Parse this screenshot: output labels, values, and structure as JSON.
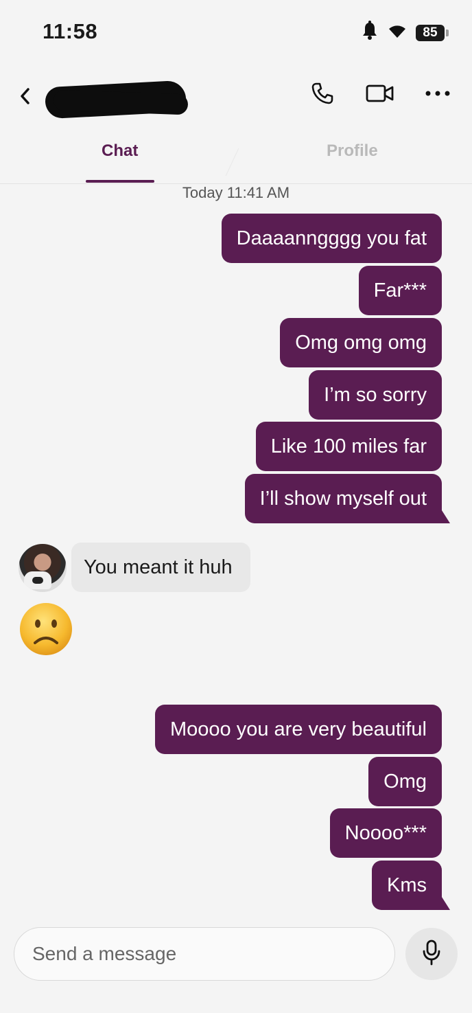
{
  "status_bar": {
    "time": "11:58",
    "battery": "85",
    "icons": [
      "bell-icon",
      "wifi-icon",
      "battery-icon"
    ]
  },
  "header": {
    "back_icon": "chevron-left-icon",
    "contact_name": "",
    "actions": [
      "phone-icon",
      "video-icon",
      "more-icon"
    ]
  },
  "tabs": {
    "chat": "Chat",
    "profile": "Profile",
    "active": "Chat"
  },
  "conversation": {
    "timestamp": "Today 11:41 AM",
    "outgoing_group_1": [
      "Daaaanngggg you fat",
      "Far***",
      "Omg omg omg",
      "I’m so sorry",
      "Like 100 miles far",
      "I’ll show myself out"
    ],
    "incoming": {
      "text": "You meant it huh",
      "emoji": "🙁"
    },
    "outgoing_group_2": [
      "Moooo you are very beautiful",
      "Omg",
      "Noooo***",
      "Kms"
    ]
  },
  "composer": {
    "placeholder": "Send a message",
    "value": "",
    "mic_icon": "microphone-icon"
  },
  "colors": {
    "accent": "#5a1d52",
    "background": "#f4f4f4",
    "incoming_bubble": "#e8e8e8",
    "inactive_tab": "#b9b9b9"
  }
}
